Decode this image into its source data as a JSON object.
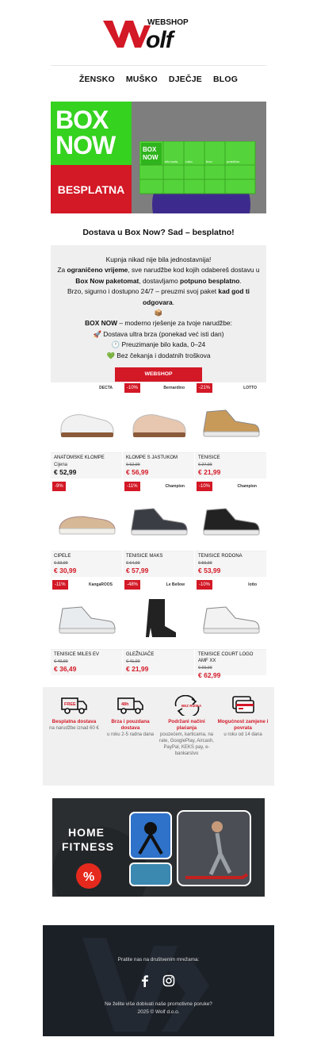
{
  "brand": {
    "small": "WEBSHOP",
    "name": "Wolf",
    "color": "#d31826"
  },
  "nav": [
    "ŽENSKO",
    "MUŠKO",
    "DJEČJE",
    "BLOG"
  ],
  "hero": {
    "line1": "BOX",
    "line2": "NOW",
    "badge": "BESPLATNA",
    "locker": {
      "line1": "BOX",
      "line2": "NOW",
      "cells": [
        "Lako",
        "brzo",
        "praktično",
        "bilo kada"
      ]
    }
  },
  "headline": "Dostava u Box Now? Sad – besplatno!",
  "promo": {
    "p1": "Kupnja nikad nije bila jednostavnija!",
    "p2a": "Za ",
    "p2b": "ograničeno vrijeme",
    "p2c": ", sve narudžbe kod kojih odabereš dostavu u ",
    "p2d": "Box Now paketomat",
    ", ": "",
    "p2e": ", dostavljamo ",
    "p2f": "potpuno besplatno",
    ".": "",
    "p3a": "Brzo, sigurno i dostupno 24/7 – preuzmi svoj paket ",
    "p3b": "kad god ti odgovara",
    "p4a": "BOX NOW",
    "p4b": " – moderno rješenje za tvoje narudžbe:",
    "b1": "🚀 Dostava ultra brza (ponekad već isti dan)",
    "b2": "🕐 Preuzimanje bilo kada, 0–24",
    "b3": "💚 Bez čekanja i dodatnih troškova",
    "button": "WEBSHOP"
  },
  "products": [
    {
      "name": "ANATOMSKE KLOMPE",
      "brand": "DECTA",
      "label": "Cijena",
      "old": "",
      "price": "€ 52,99",
      "discount": "",
      "icon": "clog-icon"
    },
    {
      "name": "KLOMPE S JASTUKOM",
      "brand": "Bernardino",
      "label": "",
      "old": "€ 62,99",
      "price": "€ 56,99",
      "discount": "-10%",
      "icon": "clog-icon"
    },
    {
      "name": "TENISICE",
      "brand": "LOTTO",
      "label": "",
      "old": "€ 27,99",
      "price": "€ 21,99",
      "discount": "-21%",
      "icon": "sneaker-icon"
    },
    {
      "name": "CIPELE",
      "brand": "",
      "label": "",
      "old": "€ 33,99",
      "price": "€ 30,99",
      "discount": "-9%",
      "icon": "loafer-icon"
    },
    {
      "name": "TENISICE MAKS",
      "brand": "Champion",
      "label": "",
      "old": "€ 64,99",
      "price": "€ 57,99",
      "discount": "-11%",
      "icon": "sneaker-icon"
    },
    {
      "name": "TENISICE RODONA",
      "brand": "Champion",
      "label": "",
      "old": "€ 59,99",
      "price": "€ 53,99",
      "discount": "-10%",
      "icon": "sneaker-icon"
    },
    {
      "name": "TENISICE MILES EV",
      "brand": "KangaROOS",
      "label": "",
      "old": "€ 40,99",
      "price": "€ 36,49",
      "discount": "-11%",
      "icon": "sneaker-icon"
    },
    {
      "name": "GLEŽNJAČE",
      "brand": "Le Bellow",
      "label": "",
      "old": "€ 41,99",
      "price": "€ 21,99",
      "discount": "-48%",
      "icon": "boot-icon"
    },
    {
      "name": "TENISICE COURT LOGO AMF XX",
      "brand": "lotto",
      "label": "",
      "old": "€ 69,99",
      "price": "€ 62,99",
      "discount": "-10%",
      "icon": "sneaker-icon"
    }
  ],
  "features": [
    {
      "icon": "truck-free-icon",
      "tag": "FREE",
      "title": "Besplatna dostava",
      "desc": "na narudžbe iznad 60 €"
    },
    {
      "icon": "truck-48h-icon",
      "tag": "48h",
      "title": "Brza i pouzdana dostava",
      "desc": "u roku 2-5 radna dana"
    },
    {
      "icon": "no-risk-icon",
      "tag": "BEZ RIZIKA",
      "title": "Podržani načini plaćanja",
      "desc": "pouzećem, karticama, na rate, GooglePlay, Aircash, PayPal, KEKS pay, e-bankarstvo"
    },
    {
      "icon": "cards-icon",
      "tag": "",
      "title": "Mogućnost zamjene i povrata",
      "desc": "u roku od 14 dana"
    }
  ],
  "fitness": {
    "line1": "HOME",
    "line2": "FITNESS",
    "badge": "%"
  },
  "footer": {
    "follow": "Pratite nas na društvenim mrežama:",
    "unsub": "Ne želite više dobivati naše promotivne poruke?",
    "copy": "2025 © Wolf d.o.o."
  }
}
